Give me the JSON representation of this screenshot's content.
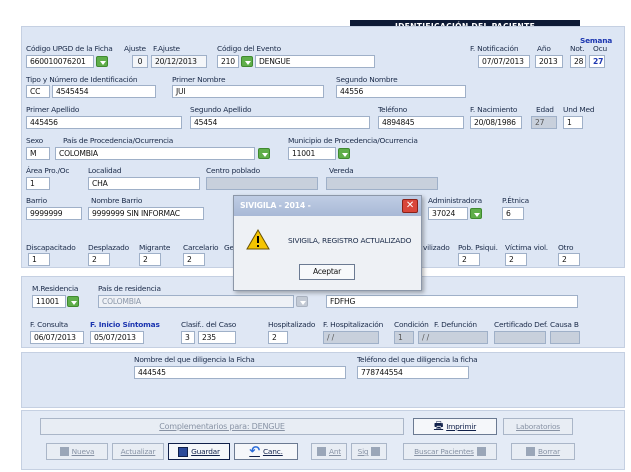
{
  "header": {
    "title": "IDENTIFICACIÓN DEL PACIENTE",
    "semana_label": "Semana",
    "notif_label": "Not.",
    "ocu_label": "Ocu"
  },
  "ficha": {
    "codigo_upgd_label": "Código UPGD de la Ficha",
    "codigo_upgd": "660010076201",
    "ajuste_label": "Ajuste",
    "ajuste": "0",
    "fajuste_label": "F.Ajuste",
    "fajuste": "20/12/2013",
    "evento_label": "Código del Evento",
    "evento_code": "210",
    "evento_name": "DENGUE",
    "fnotif_label": "F. Notificación",
    "fnotif": "07/07/2013",
    "anio_label": "Año",
    "anio": "2013",
    "sem_not": "28",
    "sem_ocu": "27"
  },
  "paciente": {
    "tipo_label": "Tipo y Número de Identificación",
    "tipo": "CC",
    "numero": "4545454",
    "nombre1_label": "Primer Nombre",
    "nombre1": "JUI",
    "nombre2_label": "Segundo Nombre",
    "nombre2": "44556",
    "apellido1_label": "Primer Apellido",
    "apellido1": "445456",
    "apellido2_label": "Segundo Apellido",
    "apellido2": "45454",
    "telefono_label": "Teléfono",
    "telefono": "4894845",
    "fnac_label": "F. Nacimiento",
    "fnac": "20/08/1986",
    "edad_label": "Edad",
    "edad": "27",
    "und_label": "Und Med",
    "und": "1",
    "sexo_label": "Sexo",
    "sexo": "M",
    "pais_label": "País de Procedencia/Ocurrencia",
    "pais": "COLOMBIA",
    "municipio_label": "Municipio de Procedencia/Ocurrencia",
    "municipio": "11001",
    "area_label": "Área Pro./Oc",
    "area": "1",
    "localidad_label": "Localidad",
    "localidad": "CHA",
    "centro_label": "Centro poblado",
    "vereda_label": "Vereda",
    "barrio_label": "Barrio",
    "barrio": "9999999",
    "nombre_barrio_label": "Nombre Barrio",
    "nombre_barrio": "9999999 SIN INFORMAC",
    "admin_label": "Administradora",
    "admin": "37024",
    "etnica_label": "P.Étnica",
    "etnica": "6"
  },
  "grupos": {
    "labels": [
      "Discapacitado",
      "Desplazado",
      "Migrante",
      "Carcelario",
      "Ge",
      "vilizado",
      "Pob. Psiqui.",
      "Víctima viol.",
      "Otro"
    ],
    "values": [
      "1",
      "2",
      "2",
      "2",
      "",
      "",
      "2",
      "2",
      "2"
    ],
    "six_label": "6"
  },
  "residencia": {
    "m_label": "M.Residencia",
    "m_value": "11001",
    "pais_label": "País de residencia",
    "pais": "COLOMBIA",
    "direccion": "FDFHG"
  },
  "caso": {
    "fconsulta_label": "F. Consulta",
    "fconsulta": "06/07/2013",
    "finicio_label": "F. Inicio Síntomas",
    "finicio": "05/07/2013",
    "clasif_label": "Clasif.. del Caso",
    "clasif1": "3",
    "clasif2": "235",
    "hosp_label": "Hospitalizado",
    "hosp": "2",
    "fhosp_label": "F. Hospitalización",
    "fhosp": "/ /",
    "condicion_label": "Condición",
    "condicion": "1",
    "fdef_label": "F. Defunción",
    "fdef": "/ /",
    "cert_label": "Certificado Def.",
    "causa_label": "Causa B"
  },
  "diligencia": {
    "nombre_label": "Nombre del que diligencia la Ficha",
    "nombre": "444545",
    "tel_label": "Teléfono del que diligencia la ficha",
    "tel": "778744554"
  },
  "actions": {
    "complementarios": "Complementarios para: DENGUE",
    "imprimir": "Imprimir",
    "laboratorios": "Laboratorios",
    "nueva": "Nueva",
    "actualizar": "Actualizar",
    "guardar": "Guardar",
    "cancelar": "Canc.",
    "ant": "Ant",
    "sig": "Sig",
    "buscar": "Buscar Pacientes",
    "borrar": "Borrar"
  },
  "dialog": {
    "title": "SIVIGILA - 2014 -",
    "message": "SIVIGILA, REGISTRO ACTUALIZADO",
    "ok": "Aceptar"
  }
}
